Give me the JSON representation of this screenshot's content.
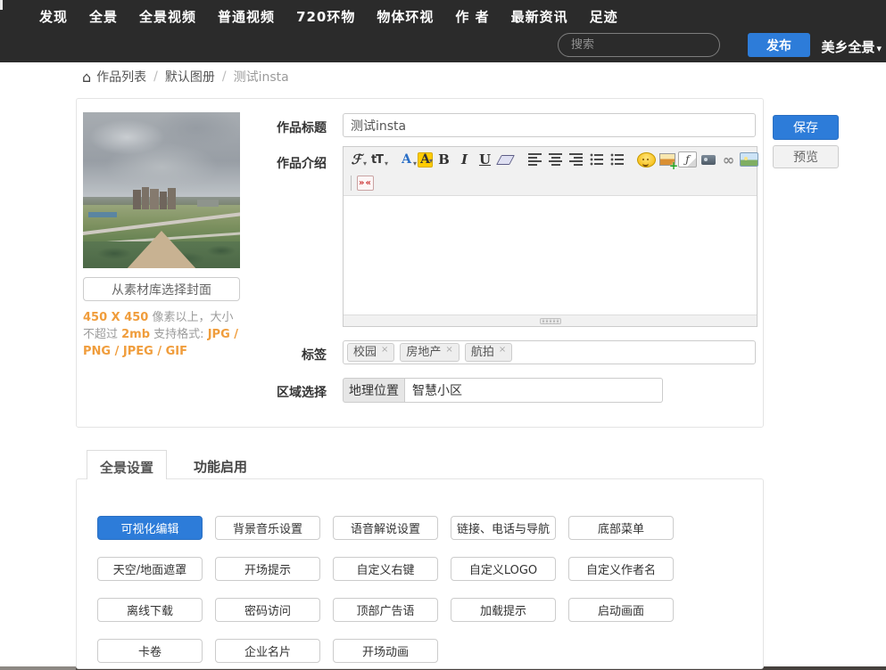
{
  "header": {
    "nav": [
      "发现",
      "全景",
      "全景视频",
      "普通视频",
      "720环物",
      "物体环视",
      "作 者",
      "最新资讯",
      "足迹"
    ],
    "search_placeholder": "搜索",
    "publish_label": "发布",
    "user_menu_label": "美乡全景",
    "colors": {
      "bar_bg": "#2b2b2b",
      "accent_blue": "#2d7cd9"
    }
  },
  "breadcrumb": {
    "home_glyph": "⌂",
    "items": [
      "作品列表",
      "默认图册",
      "测试insta"
    ]
  },
  "cover": {
    "choose_button": "从素材库选择封面",
    "hint_segments": [
      "450 X 450",
      " 像素以上，大小不超过 ",
      "2mb",
      " 支持格式: ",
      "JPG / PNG / JPEG / GIF"
    ],
    "hint_highlight_color": "#f09d3c"
  },
  "form": {
    "title_label": "作品标题",
    "title_value": "测试insta",
    "intro_label": "作品介绍",
    "tags_label": "标签",
    "tags": [
      "校园",
      "房地产",
      "航拍"
    ],
    "tag_remove_glyph": "×",
    "region_label": "区域选择",
    "region_button_label": "地理位置",
    "region_value": "智慧小区"
  },
  "editor": {
    "body_text": "",
    "icons_row1": [
      {
        "name": "font-family-icon",
        "glyph": "ℱ"
      },
      {
        "name": "font-size-icon",
        "glyph": "tT"
      },
      {
        "name": "text-color-icon",
        "glyph": "A"
      },
      {
        "name": "highlight-color-icon",
        "glyph": "A"
      },
      {
        "name": "bold-icon",
        "glyph": "B"
      },
      {
        "name": "italic-icon",
        "glyph": "I"
      },
      {
        "name": "underline-icon",
        "glyph": "U"
      },
      {
        "name": "remove-format-icon",
        "glyph": ""
      },
      {
        "name": "align-left-icon",
        "glyph": ""
      },
      {
        "name": "align-center-icon",
        "glyph": ""
      },
      {
        "name": "align-right-icon",
        "glyph": ""
      },
      {
        "name": "ordered-list-icon",
        "glyph": ""
      },
      {
        "name": "unordered-list-icon",
        "glyph": ""
      },
      {
        "name": "emoticon-icon",
        "glyph": ""
      },
      {
        "name": "insert-image-icon",
        "glyph": ""
      },
      {
        "name": "flash-icon",
        "glyph": "ƒ"
      },
      {
        "name": "media-icon",
        "glyph": ""
      },
      {
        "name": "link-icon",
        "glyph": "∞"
      },
      {
        "name": "image-icon",
        "glyph": ""
      }
    ],
    "icons_row2": [
      {
        "name": "blockquote-icon",
        "glyph": "»«"
      }
    ]
  },
  "actions": {
    "save_label": "保存",
    "preview_label": "预览"
  },
  "tabs": [
    {
      "label": "全景设置",
      "active": true
    },
    {
      "label": "功能启用",
      "active": false
    }
  ],
  "settings": {
    "buttons": [
      {
        "label": "可视化编辑",
        "active": true
      },
      {
        "label": "背景音乐设置",
        "active": false
      },
      {
        "label": "语音解说设置",
        "active": false
      },
      {
        "label": "链接、电话与导航",
        "active": false
      },
      {
        "label": "底部菜单",
        "active": false
      },
      {
        "label": "天空/地面遮罩",
        "active": false
      },
      {
        "label": "开场提示",
        "active": false
      },
      {
        "label": "自定义右键",
        "active": false
      },
      {
        "label": "自定义LOGO",
        "active": false
      },
      {
        "label": "自定义作者名",
        "active": false
      },
      {
        "label": "离线下载",
        "active": false
      },
      {
        "label": "密码访问",
        "active": false
      },
      {
        "label": "顶部广告语",
        "active": false
      },
      {
        "label": "加载提示",
        "active": false
      },
      {
        "label": "启动画面",
        "active": false
      },
      {
        "label": "卡卷",
        "active": false
      },
      {
        "label": "企业名片",
        "active": false
      },
      {
        "label": "开场动画",
        "active": false
      }
    ]
  }
}
